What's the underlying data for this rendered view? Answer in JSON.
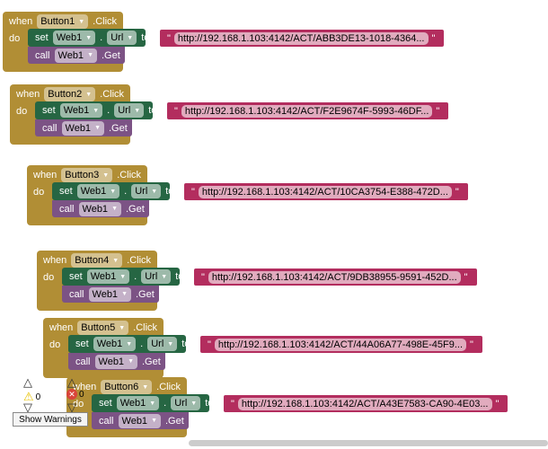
{
  "labels": {
    "when": "when",
    "do": "do",
    "set": "set",
    "to": "to",
    "call": "call",
    "click": ".Click",
    "get": ".Get",
    "dot": ".",
    "quote": "\""
  },
  "events": [
    {
      "button": "Button1",
      "component": "Web1",
      "property": "Url",
      "url": "http://192.168.1.103:4142/ACT/ABB3DE13-1018-4364..."
    },
    {
      "button": "Button2",
      "component": "Web1",
      "property": "Url",
      "url": "http://192.168.1.103:4142/ACT/F2E9674F-5993-46DF..."
    },
    {
      "button": "Button3",
      "component": "Web1",
      "property": "Url",
      "url": "http://192.168.1.103:4142/ACT/10CA3754-E388-472D..."
    },
    {
      "button": "Button4",
      "component": "Web1",
      "property": "Url",
      "url": "http://192.168.1.103:4142/ACT/9DB38955-9591-452D..."
    },
    {
      "button": "Button5",
      "component": "Web1",
      "property": "Url",
      "url": "http://192.168.1.103:4142/ACT/44A06A77-498E-45F9..."
    },
    {
      "button": "Button6",
      "component": "Web1",
      "property": "Url",
      "url": "http://192.168.1.103:4142/ACT/A43E7583-CA90-4E03..."
    }
  ],
  "warnings": {
    "warning_count": "0",
    "error_count": "0",
    "show_warnings_label": "Show Warnings"
  },
  "colors": {
    "event": "#b18e35",
    "setter": "#266643",
    "method": "#7c5385",
    "text": "#b32d5e"
  }
}
